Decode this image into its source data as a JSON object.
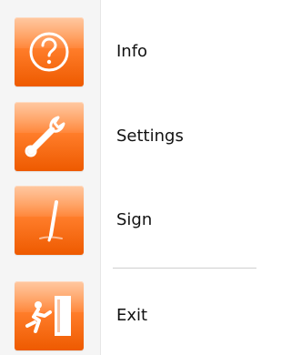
{
  "menu": {
    "items": [
      {
        "label": "Info",
        "icon": "question-icon"
      },
      {
        "label": "Settings",
        "icon": "wrench-icon"
      },
      {
        "label": "Sign",
        "icon": "pen-icon"
      },
      {
        "label": "Exit",
        "icon": "exit-door-icon"
      }
    ],
    "colors": {
      "tile_top": "#ff9b54",
      "tile_bottom": "#ee5a00",
      "icon_stroke": "#ffffff"
    }
  }
}
